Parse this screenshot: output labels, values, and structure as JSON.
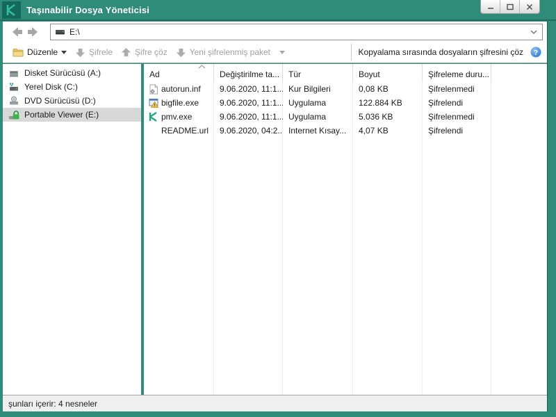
{
  "window": {
    "title": "Taşınabilir Dosya Yöneticisi"
  },
  "navbar": {
    "address": "E:\\"
  },
  "toolbar": {
    "buttons": [
      {
        "label": "Düzenle",
        "enabled": true
      },
      {
        "label": "Şifrele",
        "enabled": false
      },
      {
        "label": "Şifre çöz",
        "enabled": false
      },
      {
        "label": "Yeni şifrelenmiş paket",
        "enabled": false
      }
    ],
    "right_label": "Kopyalama sırasında dosyaların şifresini çöz"
  },
  "sidebar": {
    "items": [
      {
        "label": "Disket Sürücüsü (A:)",
        "icon": "floppy-drive-icon",
        "selected": false
      },
      {
        "label": "Yerel Disk (C:)",
        "icon": "local-disk-icon",
        "selected": false
      },
      {
        "label": "DVD Sürücüsü (D:)",
        "icon": "dvd-drive-icon",
        "selected": false
      },
      {
        "label": "Portable Viewer (E:)",
        "icon": "locked-drive-icon",
        "selected": true
      }
    ]
  },
  "filelist": {
    "columns": [
      "Ad",
      "Değiştirilme ta...",
      "Tür",
      "Boyut",
      "Şifreleme duru..."
    ],
    "rows": [
      {
        "name": "autorun.inf",
        "icon": "setup-file-icon",
        "modified": "9.06.2020, 11:1...",
        "type": "Kur Bilgileri",
        "size": "0,08 KB",
        "encryption": "Şifrelenmedi"
      },
      {
        "name": "bigfile.exe",
        "icon": "application-file-icon",
        "modified": "9.06.2020, 11:1...",
        "type": "Uygulama",
        "size": "122.884 KB",
        "encryption": "Şifrelendi"
      },
      {
        "name": "pmv.exe",
        "icon": "kaspersky-file-icon",
        "modified": "9.06.2020, 11:1...",
        "type": "Uygulama",
        "size": "5.036 KB",
        "encryption": "Şifrelenmedi"
      },
      {
        "name": "README.url",
        "icon": "none",
        "modified": "9.06.2020, 04:2...",
        "type": "Internet Kısay...",
        "size": "4,07 KB",
        "encryption": "Şifrelendi"
      }
    ]
  },
  "statusbar": {
    "text": "şunları içerir: 4 nesneler"
  },
  "colors": {
    "accent_teal": "#2E8C79",
    "dark_teal": "#15695A",
    "kaspersky_green": "#36BD9E",
    "help_blue": "#3F8FDE",
    "selected_gray": "#d8d8d8"
  }
}
